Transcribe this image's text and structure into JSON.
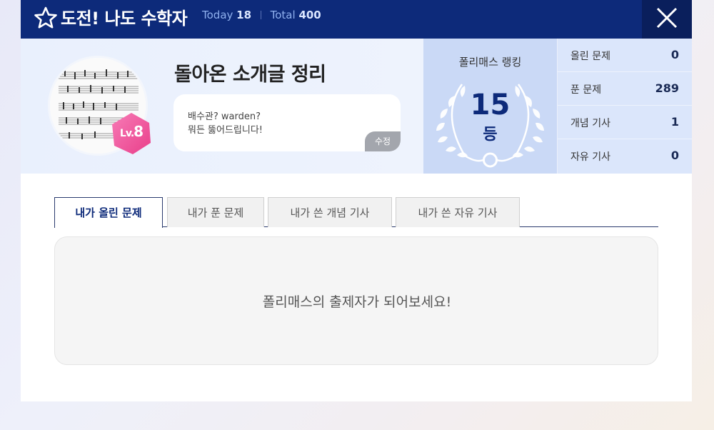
{
  "header": {
    "title": "도전! 나도 수학자",
    "today_label": "Today",
    "today_value": "18",
    "total_label": "Total",
    "total_value": "400",
    "close_icon": "close-icon",
    "star_icon": "star-icon"
  },
  "profile": {
    "username": "돌아온 소개글 정리",
    "level_prefix": "Lv.",
    "level_value": "8",
    "intro_line1": "배수관? warden?",
    "intro_line2": "뭐든 뚫어드립니다!",
    "edit_label": "수정",
    "avatar_icon": "sheet-music-image"
  },
  "ranking": {
    "label": "폴리매스 랭킹",
    "rank": "15",
    "unit": "등"
  },
  "stats": [
    {
      "label": "올린 문제",
      "value": "0"
    },
    {
      "label": "푼 문제",
      "value": "289"
    },
    {
      "label": "개념 기사",
      "value": "1"
    },
    {
      "label": "자유 기사",
      "value": "0"
    }
  ],
  "tabs": [
    {
      "label": "내가 올린 문제",
      "active": true
    },
    {
      "label": "내가 푼 문제",
      "active": false
    },
    {
      "label": "내가 쓴 개념 기사",
      "active": false
    },
    {
      "label": "내가 쓴 자유 기사",
      "active": false
    }
  ],
  "content": {
    "empty_message": "폴리매스의 출제자가 되어보세요!"
  },
  "colors": {
    "header_bg": "#0d2a7a",
    "rank_bg": "#cad9f6",
    "level_badge": "#f0559a"
  }
}
